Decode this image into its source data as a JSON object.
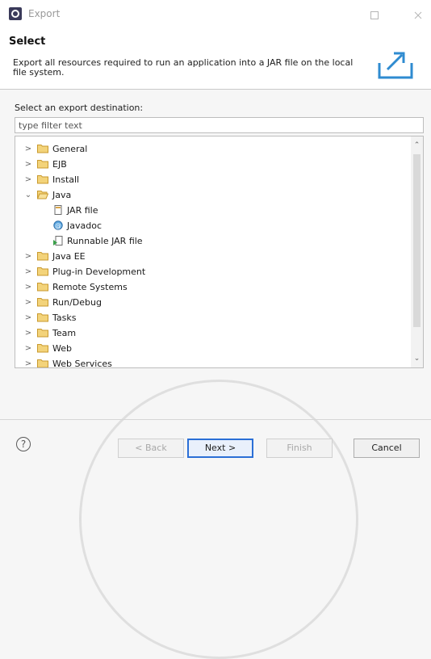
{
  "window": {
    "title": "Export"
  },
  "header": {
    "title": "Select",
    "description": "Export all resources required to run an application into a JAR file on the local file system."
  },
  "destination": {
    "label": "Select an export destination:",
    "filter_placeholder": "type filter text"
  },
  "tree": {
    "items": [
      {
        "label": "General",
        "expanded": false,
        "icon": "folder-icon"
      },
      {
        "label": "EJB",
        "expanded": false,
        "icon": "folder-icon"
      },
      {
        "label": "Install",
        "expanded": false,
        "icon": "folder-icon"
      },
      {
        "label": "Java",
        "expanded": true,
        "icon": "folder-open-icon"
      },
      {
        "label": "JAR file",
        "icon": "jar-file-icon"
      },
      {
        "label": "Javadoc",
        "icon": "javadoc-icon"
      },
      {
        "label": "Runnable JAR file",
        "icon": "runnable-jar-icon"
      },
      {
        "label": "Java EE",
        "expanded": false,
        "icon": "folder-icon"
      },
      {
        "label": "Plug-in Development",
        "expanded": false,
        "icon": "folder-icon"
      },
      {
        "label": "Remote Systems",
        "expanded": false,
        "icon": "folder-icon"
      },
      {
        "label": "Run/Debug",
        "expanded": false,
        "icon": "folder-icon"
      },
      {
        "label": "Tasks",
        "expanded": false,
        "icon": "folder-icon"
      },
      {
        "label": "Team",
        "expanded": false,
        "icon": "folder-icon"
      },
      {
        "label": "Web",
        "expanded": false,
        "icon": "folder-icon"
      },
      {
        "label": "Web Services",
        "expanded": false,
        "icon": "folder-icon"
      }
    ]
  },
  "buttons": {
    "back": "< Back",
    "next": "Next >",
    "finish": "Finish",
    "cancel": "Cancel",
    "help": "?"
  },
  "colors": {
    "accent": "#2b6fd6",
    "folder": "#e8b84a"
  }
}
